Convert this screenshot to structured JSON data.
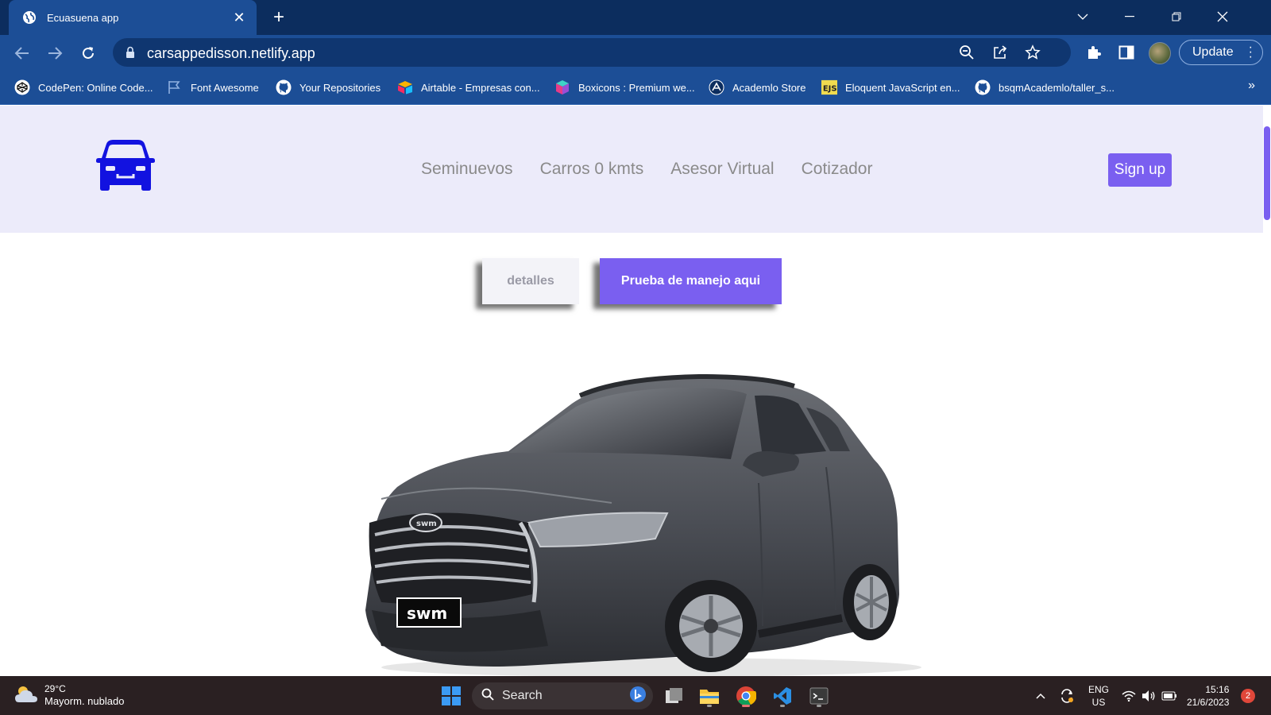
{
  "browser": {
    "tab_title": "Ecuasuena app",
    "url": "carsappedisson.netlify.app",
    "update_label": "Update",
    "bookmarks": [
      {
        "label": "CodePen: Online Code...",
        "icon": "codepen-icon"
      },
      {
        "label": "Font Awesome",
        "icon": "flag-icon"
      },
      {
        "label": "Your Repositories",
        "icon": "github-icon"
      },
      {
        "label": "Airtable - Empresas con...",
        "icon": "airtable-icon"
      },
      {
        "label": "Boxicons : Premium we...",
        "icon": "boxicons-icon"
      },
      {
        "label": "Academlo Store",
        "icon": "academlo-icon"
      },
      {
        "label": "Eloquent JavaScript en...",
        "icon": "ejs-icon"
      },
      {
        "label": "bsqmAcademlo/taller_s...",
        "icon": "github-icon"
      }
    ],
    "bookmarks_more": "»"
  },
  "site": {
    "nav": [
      "Seminuevos",
      "Carros 0 kmts",
      "Asesor Virtual",
      "Cotizador"
    ],
    "signup_label": "Sign up",
    "detalles_label": "detalles",
    "prueba_label": "Prueba de manejo aqui",
    "car_plate": "swm",
    "car_badge": "swm",
    "accent_color": "#7a5ff0",
    "logo_color": "#1212e0"
  },
  "taskbar": {
    "weather_temp": "29°C",
    "weather_desc": "Mayorm. nublado",
    "search_label": "Search",
    "lang_line1": "ENG",
    "lang_line2": "US",
    "time": "15:16",
    "date": "21/6/2023",
    "notification_count": "2"
  }
}
